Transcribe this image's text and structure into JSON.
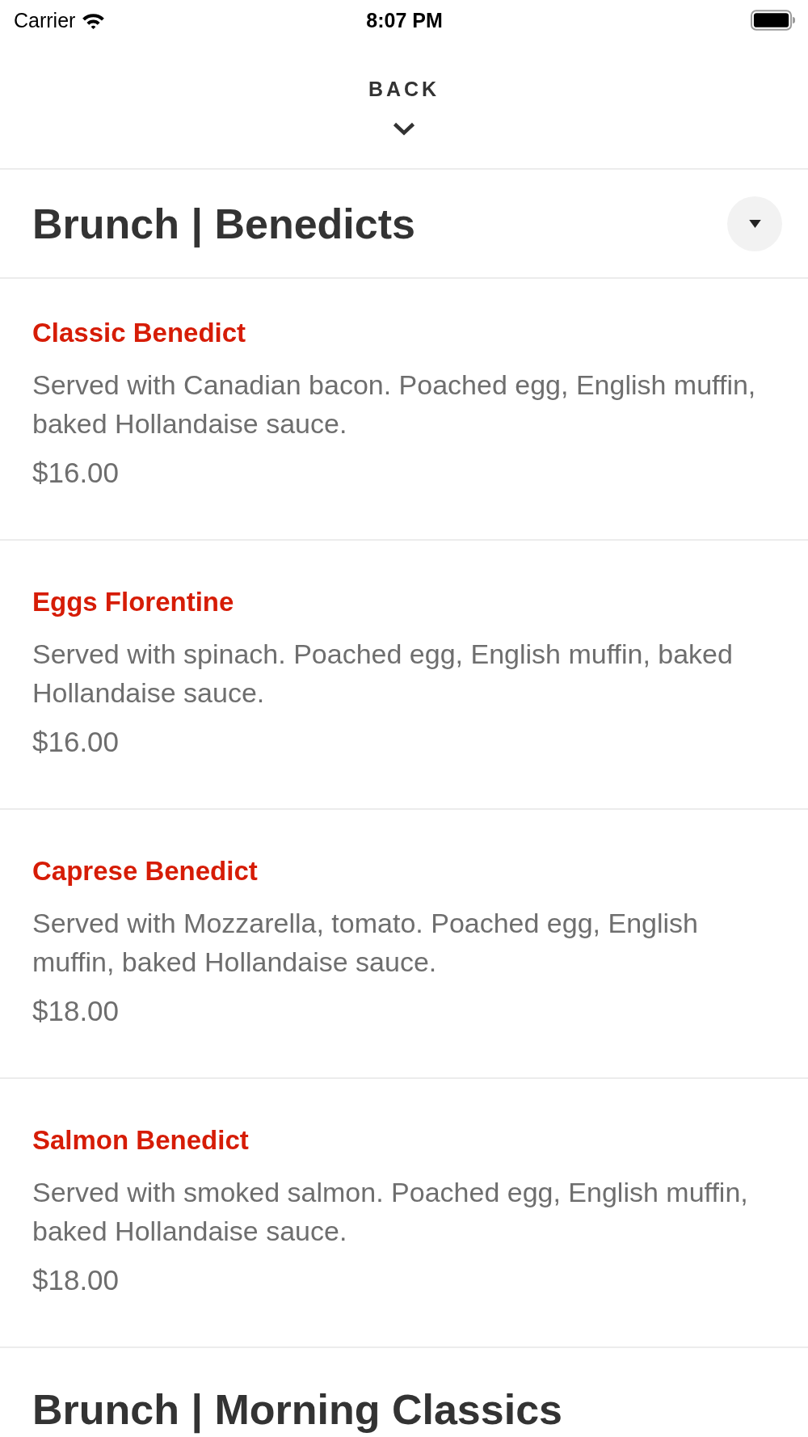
{
  "status_bar": {
    "carrier": "Carrier",
    "time": "8:07 PM"
  },
  "header": {
    "back_label": "BACK"
  },
  "sections": [
    {
      "title": "Brunch | Benedicts",
      "toggle_button": true,
      "items": [
        {
          "name": "Classic Benedict",
          "description": "Served with Canadian bacon. Poached egg, English muffin, baked Hollandaise sauce.",
          "price": "$16.00"
        },
        {
          "name": "Eggs Florentine",
          "description": "Served with spinach. Poached egg, English muffin, baked Hollandaise sauce.",
          "price": "$16.00"
        },
        {
          "name": "Caprese Benedict",
          "description": "Served with Mozzarella, tomato. Poached egg, English muffin, baked Hollandaise sauce.",
          "price": "$18.00"
        },
        {
          "name": "Salmon Benedict",
          "description": "Served with smoked salmon. Poached egg, English muffin, baked Hollandaise sauce.",
          "price": "$18.00"
        }
      ]
    },
    {
      "title": "Brunch | Morning Classics",
      "toggle_button": false
    }
  ]
}
